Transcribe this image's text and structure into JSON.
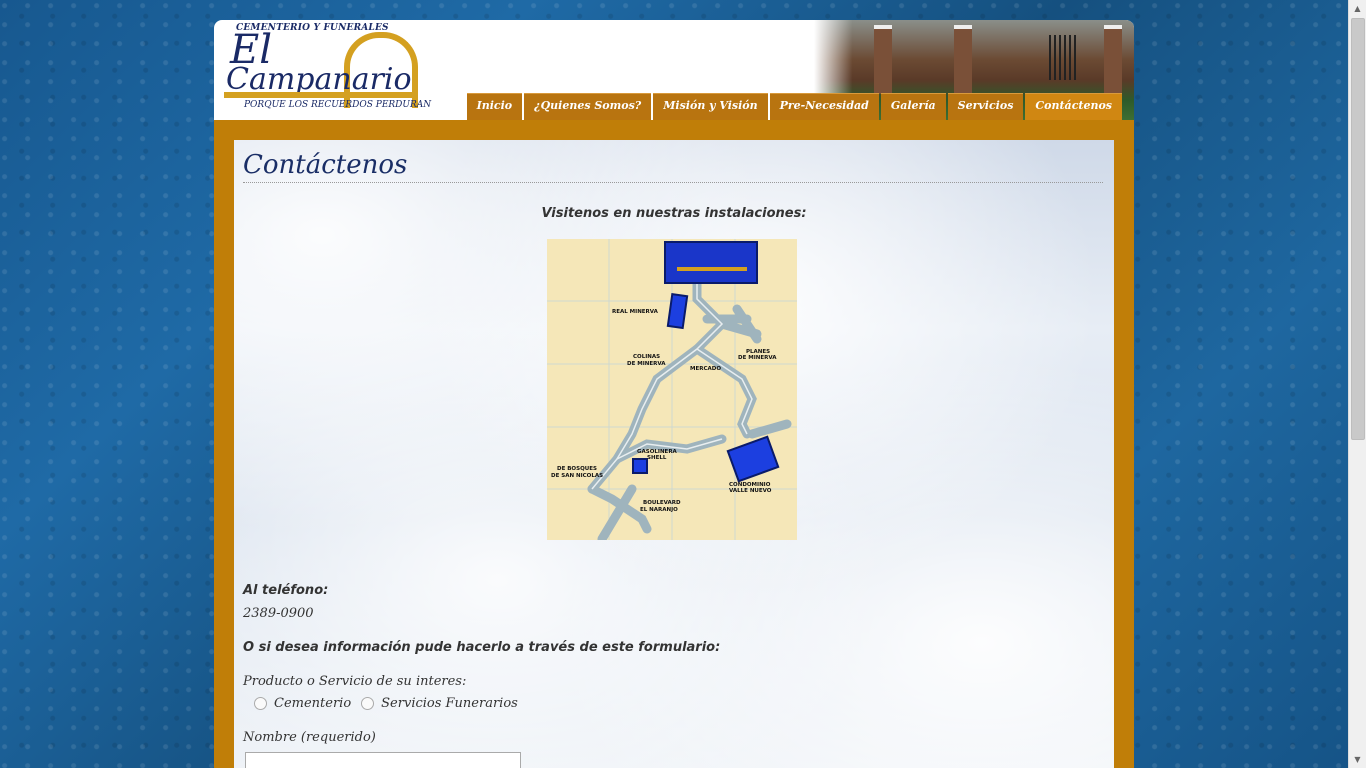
{
  "logo": {
    "tagline_top": "CEMENTERIO Y FUNERALES",
    "brand_line1": "El",
    "brand_line2": "Campanario",
    "tagline_bottom": "PORQUE LOS RECUERDOS PERDURAN"
  },
  "nav": {
    "tabs": [
      {
        "label": "Inicio"
      },
      {
        "label": "¿Quienes Somos?"
      },
      {
        "label": "Misión y Visión"
      },
      {
        "label": "Pre-Necesidad"
      },
      {
        "label": "Galería"
      },
      {
        "label": "Servicios"
      },
      {
        "label": "Contáctenos"
      }
    ],
    "active": "Contáctenos"
  },
  "page": {
    "title": "Contáctenos",
    "visit_heading": "Visitenos en nuestras instalaciones:",
    "phone_label": "Al teléfono:",
    "phone_value": "2389-0900",
    "form_intro": "O si desea información pude hacerlo a través de este formulario:",
    "product_label": "Producto o Servicio de su interes:",
    "options": [
      "Cementerio",
      "Servicios Funerarios"
    ],
    "name_label": "Nombre (requerido)"
  },
  "map": {
    "labels": {
      "real_minerva": "REAL MINERVA",
      "colinas1": "COLINAS",
      "colinas2": "DE MINERVA",
      "planes1": "PLANES",
      "planes2": "DE MINERVA",
      "mercado": "MERCADO",
      "gasolinera1": "GASOLINERA",
      "gasolinera2": "SHELL",
      "bosques1": "DE BOSQUES",
      "bosques2": "DE SAN NICOLAS",
      "condominio1": "CONDOMINIO",
      "condominio2": "VALLE NUEVO",
      "boulevard1": "BOULEVARD",
      "boulevard2": "EL NARANJO"
    }
  },
  "colors": {
    "nav_tab": "#b87410",
    "nav_active": "#d08712",
    "frame": "#c07e08",
    "title": "#1a2e66",
    "background": "#1b5e96"
  }
}
